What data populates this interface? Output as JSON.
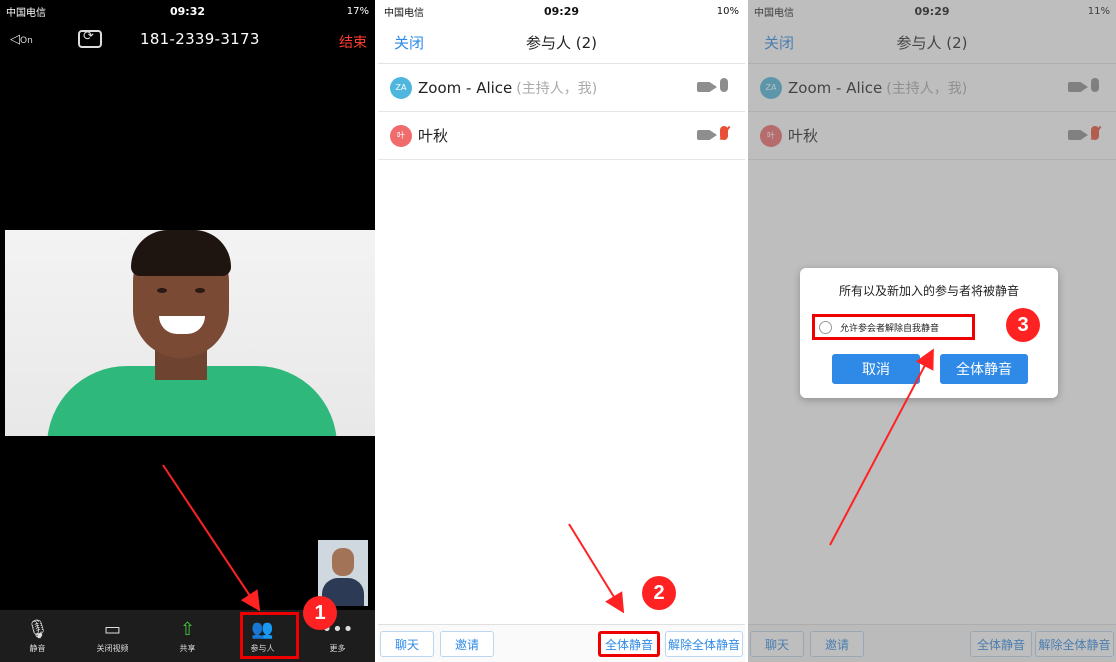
{
  "colors": {
    "accent": "#2e8ae6",
    "annotation": "#ff2222",
    "end_call": "#ff3b30"
  },
  "panel1": {
    "status": {
      "carrier": "中国电信",
      "time": "09:32",
      "battery": "17%"
    },
    "speaker_label": "On",
    "phone_number": "181-2339-3173",
    "end_label": "结束",
    "toolbar": [
      {
        "icon": "microphone-icon",
        "label": "静音"
      },
      {
        "icon": "video-camera-icon",
        "label": "关闭视频"
      },
      {
        "icon": "share-icon",
        "label": "共享"
      },
      {
        "icon": "participants-icon",
        "label": "参与人"
      },
      {
        "icon": "more-icon",
        "label": "更多"
      }
    ],
    "step_badge": "1"
  },
  "panel2": {
    "status": {
      "carrier": "中国电信",
      "time": "09:29",
      "battery": "10%"
    },
    "close_label": "关闭",
    "title": "参与人 (2)",
    "participants": [
      {
        "initials": "ZA",
        "name": "Zoom - Alice",
        "role": "(主持人，我)",
        "color": "#4fb7dd",
        "mic_muted": false
      },
      {
        "initials": "叶",
        "name": "叶秋",
        "role": "",
        "color": "#f06b6b",
        "mic_muted": true
      }
    ],
    "buttons": {
      "chat": "聊天",
      "invite": "邀请",
      "mute_all": "全体静音",
      "unmute_all": "解除全体静音"
    },
    "step_badge": "2"
  },
  "panel3": {
    "status": {
      "carrier": "中国电信",
      "time": "09:29",
      "battery": "11%"
    },
    "close_label": "关闭",
    "title": "参与人 (2)",
    "participants": [
      {
        "initials": "ZA",
        "name": "Zoom - Alice",
        "role": "(主持人，我)",
        "color": "#4fb7dd",
        "mic_muted": false
      },
      {
        "initials": "叶",
        "name": "叶秋",
        "role": "",
        "color": "#f06b6b",
        "mic_muted": true
      }
    ],
    "buttons": {
      "chat": "聊天",
      "invite": "邀请",
      "mute_all": "全体静音",
      "unmute_all": "解除全体静音"
    },
    "dialog": {
      "message": "所有以及新加入的参与者将被静音",
      "option": "允许参会者解除自我静音",
      "cancel": "取消",
      "confirm": "全体静音"
    },
    "step_badge": "3"
  }
}
